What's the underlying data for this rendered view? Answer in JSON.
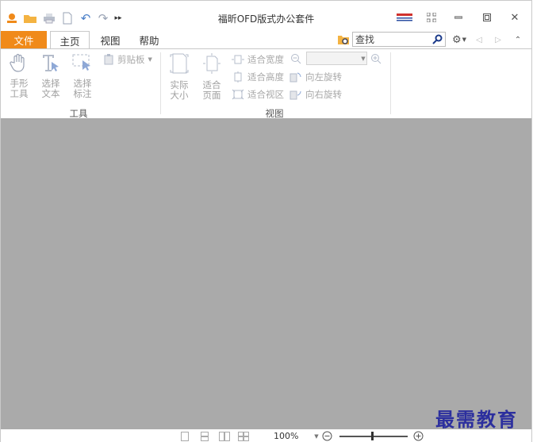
{
  "app": {
    "title": "福昕OFD版式办公套件"
  },
  "tabs": [
    {
      "label": "文件"
    },
    {
      "label": "主页"
    },
    {
      "label": "视图"
    },
    {
      "label": "帮助"
    }
  ],
  "search": {
    "value": "查找"
  },
  "ribbon": {
    "tools": {
      "hand": "手形\n工具",
      "select_text": "选择\n文本",
      "select_annot": "选择\n标注",
      "clipboard": "剪贴板",
      "group_label": "工具"
    },
    "view": {
      "actual_size": "实际\n大小",
      "fit_page": "适合\n页面",
      "fit_width": "适合宽度",
      "fit_height": "适合高度",
      "fit_view": "适合视区",
      "rotate_left": "向左旋转",
      "rotate_right": "向右旋转",
      "group_label": "视图"
    }
  },
  "status": {
    "zoom": "100%"
  },
  "watermark": "最需教育",
  "colors": {
    "accent": "#f08a1a",
    "doc_bg": "#aaaaaa",
    "watermark": "#2c2f9e"
  }
}
